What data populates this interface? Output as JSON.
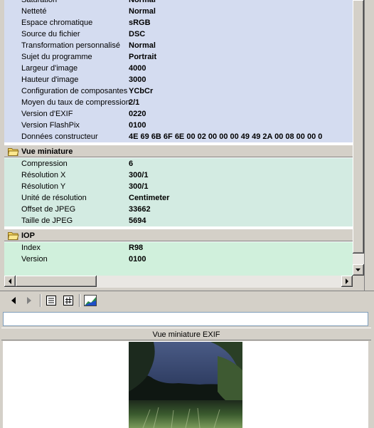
{
  "properties": {
    "partial_top": {
      "label": "Saturation",
      "value": "Normal"
    },
    "section1_rows": [
      {
        "label": "Netteté",
        "value": "Normal"
      },
      {
        "label": "Espace chromatique",
        "value": "sRGB"
      },
      {
        "label": "Source du fichier",
        "value": "DSC"
      },
      {
        "label": "Transformation personnalisé",
        "value": "Normal"
      },
      {
        "label": "Sujet du programme",
        "value": "Portrait"
      },
      {
        "label": "Largeur d'image",
        "value": "4000"
      },
      {
        "label": "Hauteur d'image",
        "value": "3000"
      },
      {
        "label": "Configuration de composantes",
        "value": "YCbCr"
      },
      {
        "label": "Moyen du taux de compression",
        "value": "2/1"
      },
      {
        "label": "Version d'EXIF",
        "value": "0220"
      },
      {
        "label": "Version FlashPix",
        "value": "0100"
      },
      {
        "label": "Données constructeur",
        "value": "4E 69 6B 6F 6E 00 02 00 00 00 49 49 2A 00 08 00 00 0"
      }
    ],
    "group_thumbnail": {
      "title": "Vue miniature",
      "rows": [
        {
          "label": "Compression",
          "value": "6"
        },
        {
          "label": "Résolution X",
          "value": "300/1"
        },
        {
          "label": "Résolution Y",
          "value": "300/1"
        },
        {
          "label": "Unité de résolution",
          "value": "Centimeter"
        },
        {
          "label": "Offset de JPEG",
          "value": "33662"
        },
        {
          "label": "Taille de JPEG",
          "value": "5694"
        }
      ]
    },
    "group_iop": {
      "title": "IOP",
      "rows": [
        {
          "label": "Index",
          "value": "R98"
        },
        {
          "label": "Version",
          "value": "0100"
        }
      ]
    }
  },
  "toolbar": {
    "icons": [
      "back-arrow-icon",
      "forward-arrow-icon",
      "list-view-icon",
      "hash-view-icon",
      "histogram-icon"
    ]
  },
  "path_field": {
    "value": ""
  },
  "preview": {
    "title": "Vue miniature EXIF"
  },
  "colors": {
    "section1": "#d4dcf0",
    "section2": "#d3ebe2",
    "section3": "#d0f0dc",
    "folder": "#f4d35e"
  }
}
